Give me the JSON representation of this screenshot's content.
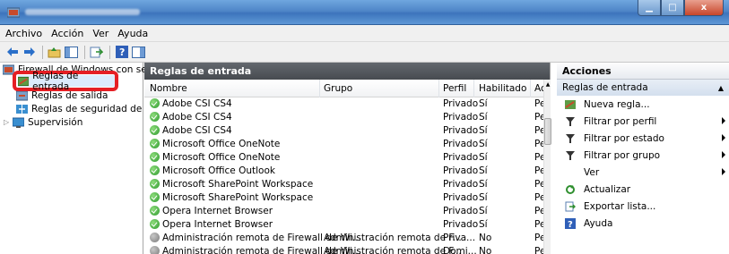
{
  "window": {
    "title": "",
    "buttons": {
      "minimize": "▁",
      "maximize": "□",
      "close": "x"
    }
  },
  "menubar": [
    "Archivo",
    "Acción",
    "Ver",
    "Ayuda"
  ],
  "tree": {
    "root": "Firewall de Windows con seguridad avanzada en Equipo local",
    "root_visible": "Firewall de Windows con segur",
    "items": [
      {
        "label": "Reglas de entrada",
        "selected": true
      },
      {
        "label": "Reglas de salida"
      },
      {
        "label": "Reglas de seguridad de con"
      },
      {
        "label": "Supervisión"
      }
    ]
  },
  "center": {
    "header": "Reglas de entrada",
    "columns": [
      "Nombre",
      "Grupo",
      "Perfil",
      "Habilitado",
      "Ac"
    ],
    "rows": [
      {
        "name": "Adobe CSI CS4",
        "group": "",
        "profile": "Privado",
        "enabled": "Sí",
        "action": "Pe",
        "status": "enabled"
      },
      {
        "name": "Adobe CSI CS4",
        "group": "",
        "profile": "Privado",
        "enabled": "Sí",
        "action": "Pe",
        "status": "enabled"
      },
      {
        "name": "Adobe CSI CS4",
        "group": "",
        "profile": "Privado",
        "enabled": "Sí",
        "action": "Pe",
        "status": "enabled"
      },
      {
        "name": "Microsoft Office OneNote",
        "group": "",
        "profile": "Privado",
        "enabled": "Sí",
        "action": "Pe",
        "status": "enabled"
      },
      {
        "name": "Microsoft Office OneNote",
        "group": "",
        "profile": "Privado",
        "enabled": "Sí",
        "action": "Pe",
        "status": "enabled"
      },
      {
        "name": "Microsoft Office Outlook",
        "group": "",
        "profile": "Privado",
        "enabled": "Sí",
        "action": "Pe",
        "status": "enabled"
      },
      {
        "name": "Microsoft SharePoint Workspace",
        "group": "",
        "profile": "Privado",
        "enabled": "Sí",
        "action": "Pe",
        "status": "enabled"
      },
      {
        "name": "Microsoft SharePoint Workspace",
        "group": "",
        "profile": "Privado",
        "enabled": "Sí",
        "action": "Pe",
        "status": "enabled"
      },
      {
        "name": "Opera Internet Browser",
        "group": "",
        "profile": "Privado",
        "enabled": "Sí",
        "action": "Pe",
        "status": "enabled"
      },
      {
        "name": "Opera Internet Browser",
        "group": "",
        "profile": "Privado",
        "enabled": "Sí",
        "action": "Pe",
        "status": "enabled"
      },
      {
        "name": "Administración remota de Firewall de Wi...",
        "group": "Administración remota de F...",
        "profile": "Priva...",
        "enabled": "No",
        "action": "Pe",
        "status": "disabled"
      },
      {
        "name": "Administración remota de Firewall de Wi...",
        "group": "Administración remota de F...",
        "profile": "Domi...",
        "enabled": "No",
        "action": "Pe",
        "status": "disabled"
      }
    ]
  },
  "actions": {
    "header": "Acciones",
    "section": "Reglas de entrada",
    "items": [
      {
        "label": "Nueva regla...",
        "icon": "new-rule-icon",
        "submenu": false
      },
      {
        "label": "Filtrar por perfil",
        "icon": "filter-icon",
        "submenu": true
      },
      {
        "label": "Filtrar por estado",
        "icon": "filter-icon",
        "submenu": true
      },
      {
        "label": "Filtrar por grupo",
        "icon": "filter-icon",
        "submenu": true
      },
      {
        "label": "Ver",
        "icon": "",
        "submenu": true
      },
      {
        "label": "Actualizar",
        "icon": "refresh-icon",
        "submenu": false
      },
      {
        "label": "Exportar lista...",
        "icon": "export-icon",
        "submenu": false
      },
      {
        "label": "Ayuda",
        "icon": "help-icon",
        "submenu": false
      }
    ]
  },
  "colors": {
    "highlight_border": "#e51f24",
    "title_bar": "#4f86c8"
  }
}
